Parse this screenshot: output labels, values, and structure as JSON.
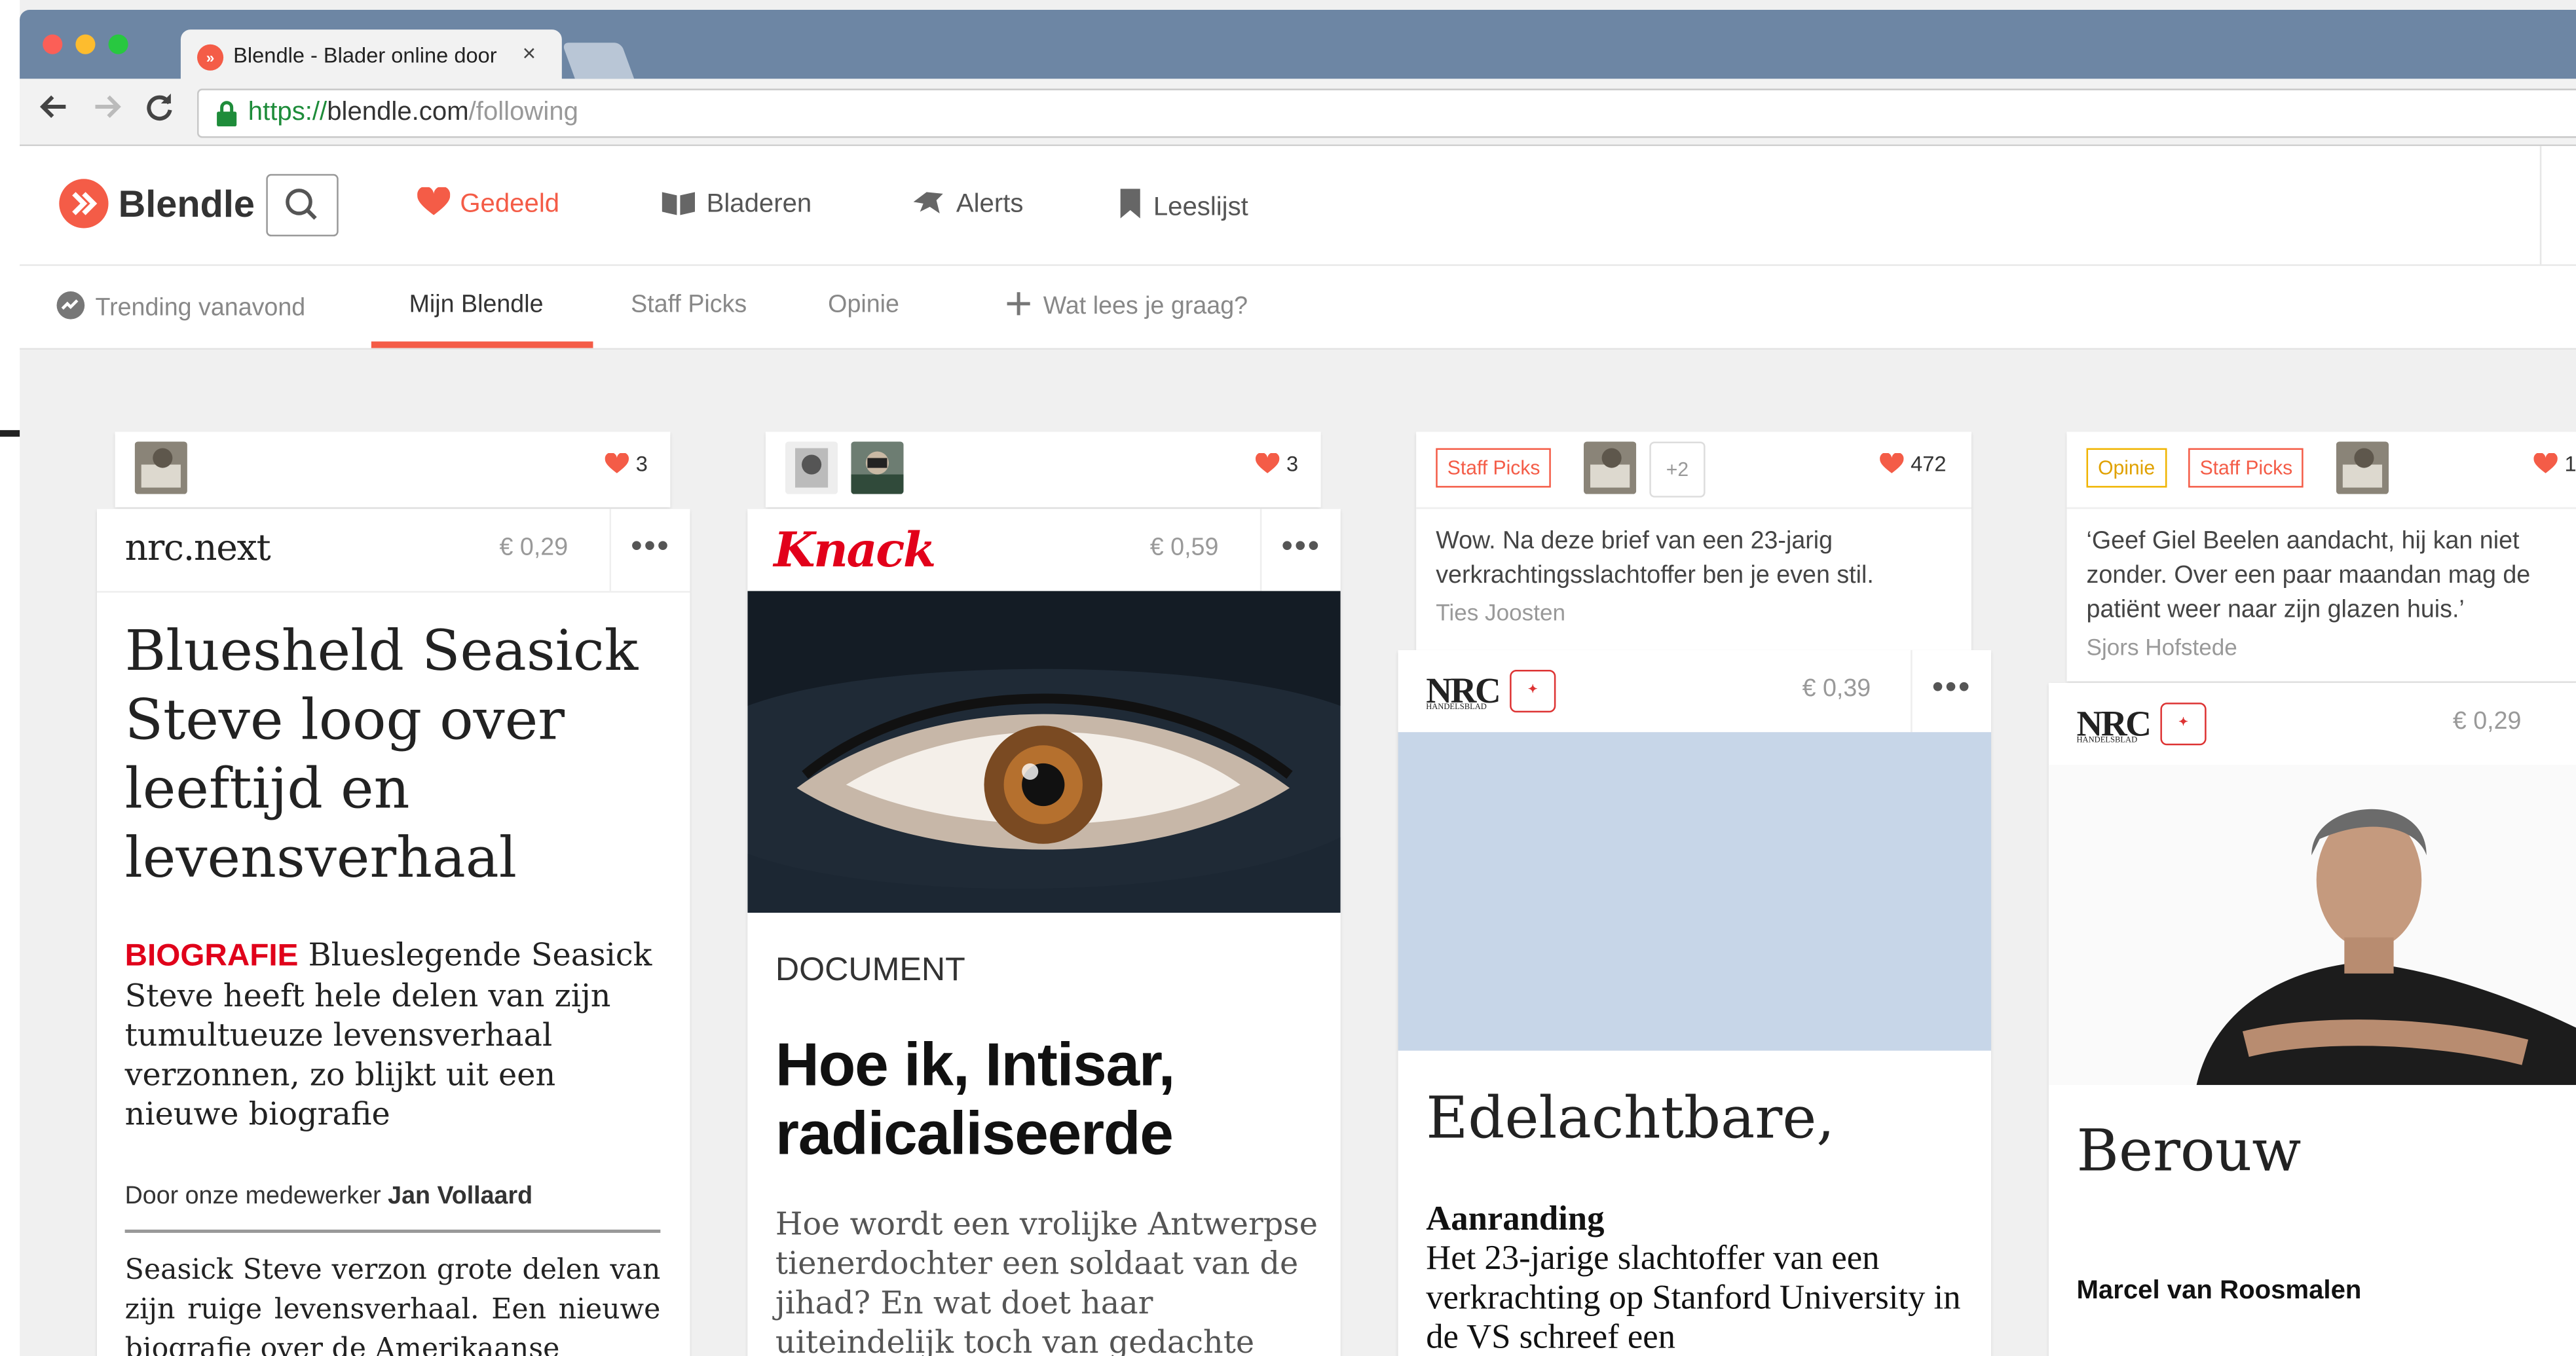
{
  "browser": {
    "tab_title": "Blendle - Blader online door",
    "tab_close": "×",
    "url_scheme": "https://",
    "url_host": "blendle.com",
    "url_path": "/following"
  },
  "header": {
    "brand": "Blendle",
    "nav": [
      {
        "label": "Gedeeld",
        "icon": "heart-icon",
        "color": "#f45c47"
      },
      {
        "label": "Bladeren",
        "icon": "book-icon"
      },
      {
        "label": "Alerts",
        "icon": "bird-icon"
      },
      {
        "label": "Leeslijst",
        "icon": "bookmark-icon"
      }
    ]
  },
  "subnav": {
    "items": [
      "Trending vanavond",
      "Mijn Blendle",
      "Staff Picks",
      "Opinie",
      "Wat lees je graag?"
    ],
    "active": "Mijn Blendle"
  },
  "colors": {
    "accent": "#f45c47",
    "opinion": "#f0b400",
    "placeholder": "#c7d6e8"
  },
  "cards": [
    {
      "likes": "3",
      "publisher": "nrc.next",
      "price": "€ 0,29",
      "more": "•••",
      "title": "Bluesheld Seasick Steve loog over leeftijd en levensverhaal",
      "kicker": "BIOGRAFIE",
      "intro": "Blueslegende Seasick Steve heeft hele delen van zijn tumultueuze levensverhaal verzonnen, zo blijkt uit een nieuwe biografie",
      "byline_prefix": "Door onze medewerker",
      "byline_name": "Jan Vollaard",
      "body": "Seasick Steve verzon grote delen van zijn ruige levensverhaal. Een nieuwe biografie over de Amerikaanse"
    },
    {
      "likes": "3",
      "publisher": "Knack",
      "price": "€ 0,59",
      "more": "•••",
      "section": "DOCUMENT",
      "title": "Hoe ik, Intisar, radicaliseerde",
      "intro": "Hoe wordt een vrolijke Antwerpse tienerdochter een soldaat van de jihad? En wat doet haar uiteindelijk toch van gedachte"
    },
    {
      "tag": "Staff Picks",
      "extra_avatars": "+2",
      "likes": "472",
      "comment": "Wow. Na deze brief van een 23-jarig verkrachtingsslachtoffer ben je even stil.",
      "comment_author": "Ties Joosten",
      "publisher": "NRC",
      "publisher_sub": "HANDELSBLAD",
      "price": "€ 0,39",
      "more": "•••",
      "title": "Edelachtbare,",
      "subtitle": "Aanranding",
      "intro": "Het 23-jarige slachtoffer van een verkrachting op Stanford University in de VS schreef een"
    },
    {
      "tags": [
        "Opinie",
        "Staff Picks"
      ],
      "likes": "1",
      "comment": "‘Geef Giel Beelen aandacht, hij kan niet zonder. Over een paar maandan mag de patiënt weer naar zijn glazen huis.’",
      "comment_author": "Sjors Hofstede",
      "publisher": "NRC",
      "publisher_sub": "HANDELSBLAD",
      "price": "€ 0,29",
      "title": "Berouw",
      "author": "Marcel van Roosmalen"
    }
  ]
}
